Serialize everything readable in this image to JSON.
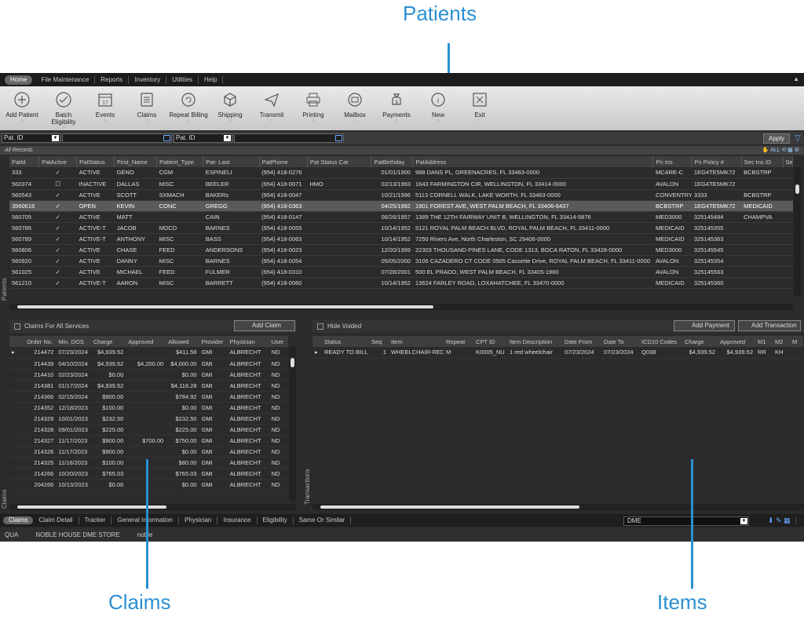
{
  "callouts": {
    "patients": "Patients",
    "claims": "Claims",
    "items": "Items"
  },
  "menu": [
    "Home",
    "File Maintenance",
    "Reports",
    "Inventory",
    "Utilities",
    "Help"
  ],
  "toolbar": [
    {
      "icon": "add-icon",
      "label": "Add Patient"
    },
    {
      "icon": "check-circle-icon",
      "label": "Batch Eligibility"
    },
    {
      "icon": "calendar-icon",
      "label": "Events",
      "cal": "17"
    },
    {
      "icon": "document-list-icon",
      "label": "Claims"
    },
    {
      "icon": "repeat-icon",
      "label": "Repeat Billing"
    },
    {
      "icon": "box-icon",
      "label": "Shipping"
    },
    {
      "icon": "paper-plane-icon",
      "label": "Transmit"
    },
    {
      "icon": "printer-icon",
      "label": "Printing"
    },
    {
      "icon": "mailbox-icon",
      "label": "Mailbox"
    },
    {
      "icon": "money-bag-icon",
      "label": "Payments"
    },
    {
      "icon": "info-icon",
      "label": "New"
    },
    {
      "icon": "close-box-icon",
      "label": "Exit"
    }
  ],
  "filters": {
    "field1": "Pat. ID",
    "field2": "Pat. ID",
    "apply": "Apply"
  },
  "all_records": "All Records",
  "all_label": "ALL",
  "patients": {
    "side_label": "Patients",
    "columns": [
      "PatId",
      "PatActive",
      "PatStatus",
      "First_Name",
      "Patient_Type",
      "Pat- Last",
      "PatPhone",
      "Pat Status Cat",
      "PatBirthday",
      "PatAddress",
      "Pri Ins",
      "Pri Policy #",
      "Sec Ins ID",
      "Se"
    ],
    "rows": [
      [
        "333",
        "✓",
        "ACTIVE",
        "GENO",
        "CGM",
        "ESPINELI",
        "(954) 418-0276",
        "",
        "01/01/1900",
        "988 DANS PL, GREENACRES, FL 33463-0000",
        "MCARE-C",
        "1EG4TE5MK72",
        "BCBSTRP"
      ],
      [
        "560374",
        "☐",
        "INACTIVE",
        "DALLAS",
        "MISC",
        "BEELER",
        "(954) 418-0071",
        "HMO",
        "02/13/1993",
        "1643 FARMINGTON CIR, WELLINGTON, FL 33414-0000",
        "AVALON",
        "1EG4TE5MK72",
        ""
      ],
      [
        "560543",
        "✓",
        "ACTIVE",
        "SCOTT",
        "SXMACH",
        "BAKERs",
        "(954) 418-0047",
        "",
        "10/21/1996",
        "5113 CORNELL WALK, LAKE WORTH, FL 33463-0000",
        "CONVENTRY",
        "3333",
        "BCBSTRP"
      ],
      [
        "3560616",
        "✓",
        "OPEN",
        "KEVIN",
        "CONC",
        "GREGG",
        "(954) 418-0363",
        "",
        "04/25/1992",
        "1901 FOREST AVE, WEST PALM BEACH, FL 33406-6437",
        "BCBSTRP",
        "1EG4TE5MK72",
        "MEDICAID"
      ],
      [
        "560705",
        "✓",
        "ACTIVE",
        "MATT",
        "",
        "CAIN",
        "(954) 418-0147",
        "",
        "06/26/1957",
        "1389 THE 12TH FAIRWAY UNIT B, WELLINGTON, FL 33414-5876",
        "MED3000",
        "325145484",
        "CHAMPVA"
      ],
      [
        "560786",
        "✓",
        "ACTIVE-T",
        "JACOB",
        "MDCD",
        "BARNES",
        "(954) 418-0055",
        "",
        "10/14/1952",
        "5121 ROYAL PALM BEACH BLVD, ROYAL PALM BEACH, FL 33411-0000",
        "MEDICAID",
        "325145355",
        ""
      ],
      [
        "560789",
        "✓",
        "ACTIVE-T",
        "ANTHONY",
        "MISC",
        "BASS",
        "(954) 418-0063",
        "",
        "10/14/1952",
        "7250 Rivers Ave, North Charleston, SC 29406-0000",
        "MEDICAID",
        "325145363",
        ""
      ],
      [
        "560806",
        "✓",
        "ACTIVE",
        "CHASE",
        "FEED",
        "ANDERSONS",
        "(954) 418-0023",
        "",
        "12/20/1999",
        "22303 THOUSAND PINES LANE, CODE 1313, BOCA RATON, FL 33428-0000",
        "MED3000",
        "325145545",
        ""
      ],
      [
        "560920",
        "✓",
        "ACTIVE",
        "DANNY",
        "MISC",
        "BARNES",
        "(954) 418-0054",
        "",
        "05/05/2000",
        "3106 CAZADERO CT CODE 0505 Cassette Drive, ROYAL PALM BEACH, FL 33411-0000",
        "AVALON",
        "325145354",
        ""
      ],
      [
        "561025",
        "✓",
        "ACTIVE",
        "MICHAEL",
        "FEED",
        "FULMER",
        "(954) 418-0310",
        "",
        "07/28/2001",
        "500 EL PRADO, WEST PALM BEACH, FL 33405-1960",
        "AVALON",
        "325145563",
        ""
      ],
      [
        "561210",
        "✓",
        "ACTIVE-T",
        "AARON",
        "MISC",
        "BARRETT",
        "(954) 418-0060",
        "",
        "10/14/1952",
        "13624 FARLEY ROAD, LOXAHATCHEE, FL 33470-0000",
        "MEDICAID",
        "325145360",
        ""
      ]
    ]
  },
  "claims": {
    "header": "Claims For All Services",
    "add_button": "Add Claim",
    "side_label": "Claims",
    "columns": [
      "Order No.",
      "Min. DOS",
      "Charge",
      "Approved",
      "Allowed",
      "Provider",
      "Physician",
      "User"
    ],
    "rows": [
      [
        "214472",
        "07/23/2024",
        "$4,939.52",
        "",
        "$411.58",
        "GMI",
        "ALBRECHT",
        "ND"
      ],
      [
        "214439",
        "04/10/2024",
        "$4,939.52",
        "$4,200.00",
        "$4,000.00",
        "GMI",
        "ALBRECHT",
        "ND"
      ],
      [
        "214410",
        "02/23/2024",
        "$0.00",
        "",
        "$0.00",
        "GMI",
        "ALBRECHT",
        "ND"
      ],
      [
        "214381",
        "01/17/2024",
        "$4,939.52",
        "",
        "$4,116.28",
        "GMI",
        "ALBRECHT",
        "ND"
      ],
      [
        "214366",
        "02/15/2024",
        "$900.00",
        "",
        "$784.92",
        "GMI",
        "ALBRECHT",
        "ND"
      ],
      [
        "214352",
        "12/18/2023",
        "$100.00",
        "",
        "$0.00",
        "GMI",
        "ALBRECHT",
        "ND"
      ],
      [
        "214329",
        "10/01/2023",
        "$232.50",
        "",
        "$232.50",
        "GMI",
        "ALBRECHT",
        "ND"
      ],
      [
        "214328",
        "09/01/2023",
        "$225.00",
        "",
        "$225.00",
        "GMI",
        "ALBRECHT",
        "ND"
      ],
      [
        "214327",
        "11/17/2023",
        "$900.00",
        "$700.00",
        "$750.00",
        "GMI",
        "ALBRECHT",
        "ND"
      ],
      [
        "214326",
        "11/17/2023",
        "$900.00",
        "",
        "$0.00",
        "GMI",
        "ALBRECHT",
        "ND"
      ],
      [
        "214325",
        "11/16/2023",
        "$100.00",
        "",
        "$80.00",
        "GMI",
        "ALBRECHT",
        "ND"
      ],
      [
        "214266",
        "10/20/2023",
        "$765.03",
        "",
        "$765.03",
        "GMI",
        "ALBRECHT",
        "ND"
      ],
      [
        "204266",
        "10/13/2023",
        "$0.00",
        "",
        "$0.00",
        "GMI",
        "ALBRECHT",
        "ND"
      ]
    ]
  },
  "transactions": {
    "hide_voided": "Hide Voided",
    "add_payment": "Add Payment",
    "add_transaction": "Add Transaction",
    "side_label": "Transactions",
    "columns": [
      "Status",
      "Seq",
      "Item",
      "Repeat",
      "CPT ID",
      "Item Description",
      "Date From",
      "Date To",
      "ICD10 Codes",
      "Charge",
      "Approved",
      "M1",
      "M2",
      "M"
    ],
    "rows": [
      [
        "READY TO BILL",
        "1",
        "WHEELCHAIR-RED",
        "M",
        "K0005_NU",
        "1 red wheelchair",
        "07/23/2024",
        "07/23/2024",
        "Q038",
        "$4,939.52",
        "$4,939.52",
        "RR",
        "KH",
        ""
      ]
    ]
  },
  "bottom_tabs": [
    "Claims",
    "Claim Detail",
    "Tracker",
    "General Information",
    "Physician",
    "Insurance",
    "Eligibility",
    "Same Or Similar"
  ],
  "dme_select": "DME",
  "status": [
    "QUA",
    "NOBLE HOUSE DME STORE",
    "noble"
  ]
}
